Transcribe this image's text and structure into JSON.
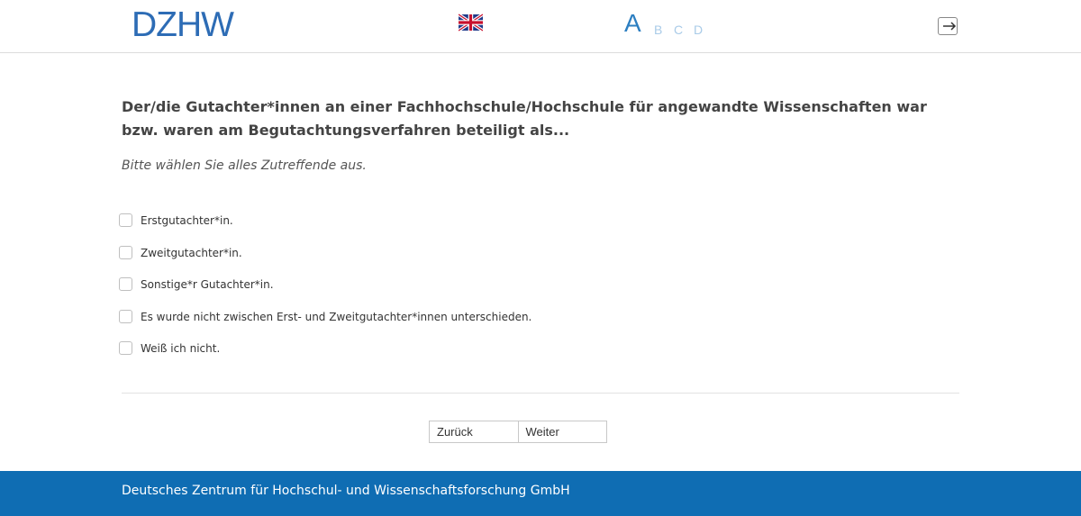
{
  "header": {
    "logo_text": "DZHW",
    "flag_icon": "uk-flag-icon",
    "pages": [
      {
        "label": "A",
        "active": true
      },
      {
        "label": "B",
        "active": false
      },
      {
        "label": "C",
        "active": false
      },
      {
        "label": "D",
        "active": false
      }
    ],
    "logout_icon": "logout-icon"
  },
  "question": {
    "text": "Der/die Gutachter*innen an einer Fachhochschule/Hochschule für angewandte Wissenschaften war bzw. waren am Begutachtungsverfahren beteiligt als...",
    "instruction": "Bitte wählen Sie alles Zutreffende aus."
  },
  "options": [
    {
      "label": "Erstgutachter*in.",
      "checked": false
    },
    {
      "label": "Zweitgutachter*in.",
      "checked": false
    },
    {
      "label": "Sonstige*r Gutachter*in.",
      "checked": false
    },
    {
      "label": "Es wurde nicht zwischen Erst- und Zweitgutachter*innen unterschieden.",
      "checked": false
    },
    {
      "label": "Weiß ich nicht.",
      "checked": false
    }
  ],
  "navigation": {
    "back_label": "Zurück",
    "next_label": "Weiter"
  },
  "footer": {
    "text": "Deutsches Zentrum für Hochschul- und Wissenschaftsforschung GmbH"
  },
  "colors": {
    "brand_blue": "#2d6cb5",
    "footer_blue": "#0f6db3",
    "page_inactive": "#a9cbe8"
  }
}
